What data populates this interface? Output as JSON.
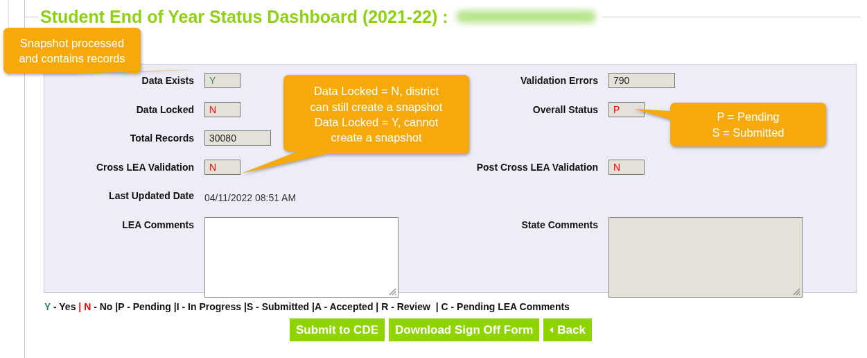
{
  "title": "Student End of Year Status Dashboard (2021-22) :",
  "rows": [
    {
      "left": {
        "label": "Data Exists",
        "kind": "box",
        "value": "Y",
        "color": "#2e8b57"
      },
      "right": {
        "label": "Validation Errors",
        "kind": "box",
        "value": "790"
      }
    },
    {
      "left": {
        "label": "Data Locked",
        "kind": "box",
        "value": "N",
        "color": "#ff0000"
      },
      "right": {
        "label": "Overall Status",
        "kind": "box",
        "value": "P",
        "color": "#ff0000"
      }
    },
    {
      "left": {
        "label": "Total Records",
        "kind": "box",
        "value": "30080"
      }
    },
    {
      "left": {
        "label": "Cross LEA Validation",
        "kind": "box",
        "value": "N",
        "color": "#ff0000"
      },
      "right": {
        "label": "Post Cross LEA Validation",
        "kind": "box",
        "value": "N",
        "color": "#ff0000"
      }
    },
    {
      "left": {
        "label": "Last Updated Date",
        "kind": "text",
        "value": "04/11/2022 08:51 AM"
      }
    },
    {
      "left": {
        "label": "LEA Comments",
        "kind": "textarea",
        "disabled": false
      },
      "right": {
        "label": "State Comments",
        "kind": "textarea",
        "disabled": true
      }
    }
  ],
  "legend": [
    {
      "text": "Y",
      "color": "#2e8b57"
    },
    {
      "text": " - Yes "
    },
    {
      "text": "| ",
      "color": "#ff0000"
    },
    {
      "text": "N",
      "color": "#ff0000"
    },
    {
      "text": " - No |P - Pending |I - In Progress |S - Submitted |A - Accepted | R - Review  | C - Pending LEA Comments"
    }
  ],
  "buttons": [
    {
      "label": "Submit to CDE",
      "kind": "plain"
    },
    {
      "label": "Download Sign Off Form",
      "kind": "plain"
    },
    {
      "label": "Back",
      "kind": "back"
    }
  ],
  "callouts": [
    {
      "lines": [
        "Snapshot processed",
        "and contains records"
      ]
    },
    {
      "lines": [
        "Data Locked = N, district",
        "can still create a snapshot",
        "Data Locked = Y, cannot",
        "create a snapshot"
      ]
    },
    {
      "lines": [
        "P = Pending",
        "S = Submitted"
      ]
    }
  ]
}
